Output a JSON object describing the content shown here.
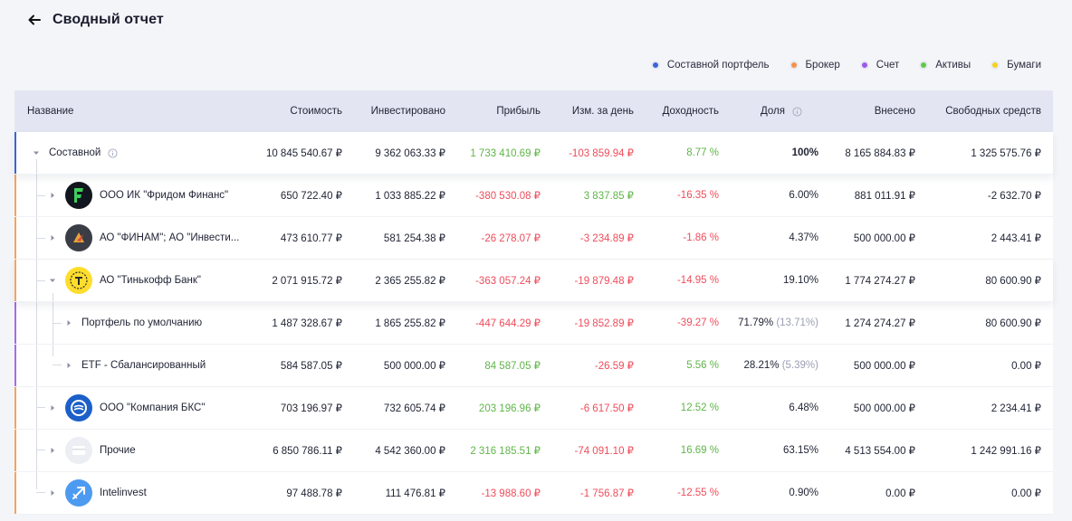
{
  "header": {
    "title": "Сводный отчет"
  },
  "legend": [
    {
      "label": "Составной портфель",
      "color": "#3a64d8"
    },
    {
      "label": "Брокер",
      "color": "#f5914a"
    },
    {
      "label": "Счет",
      "color": "#9b59e8"
    },
    {
      "label": "Активы",
      "color": "#5fc94a"
    },
    {
      "label": "Бумаги",
      "color": "#f5d21c"
    }
  ],
  "columns": {
    "name": "Название",
    "cost": "Стоимость",
    "invested": "Инвестировано",
    "profit": "Прибыль",
    "day_change": "Изм. за день",
    "yield": "Доходность",
    "share": "Доля",
    "deposited": "Внесено",
    "free_funds": "Свободных средств"
  },
  "rows": [
    {
      "name": "Составной",
      "cost": "10 845 540.67 ₽",
      "invested": "9 362 063.33 ₽",
      "profit": "1 733 410.69 ₽",
      "day_change": "-103 859.94 ₽",
      "yield": "8.77 %",
      "share": "100%",
      "share_sub": "",
      "deposited": "8 165 884.83 ₽",
      "free_funds": "1 325 575.76 ₽"
    },
    {
      "name": "ООО ИК \"Фридом Финанс\"",
      "cost": "650 722.40 ₽",
      "invested": "1 033 885.22 ₽",
      "profit": "-380 530.08 ₽",
      "day_change": "3 837.85 ₽",
      "yield": "-16.35 %",
      "share": "6.00%",
      "share_sub": "",
      "deposited": "881 011.91 ₽",
      "free_funds": "-2 632.70 ₽"
    },
    {
      "name": "АО \"ФИНАМ\"; АО \"Инвести...",
      "cost": "473 610.77 ₽",
      "invested": "581 254.38 ₽",
      "profit": "-26 278.07 ₽",
      "day_change": "-3 234.89 ₽",
      "yield": "-1.86 %",
      "share": "4.37%",
      "share_sub": "",
      "deposited": "500 000.00 ₽",
      "free_funds": "2 443.41 ₽"
    },
    {
      "name": "АО \"Тинькофф Банк\"",
      "cost": "2 071 915.72 ₽",
      "invested": "2 365 255.82 ₽",
      "profit": "-363 057.24 ₽",
      "day_change": "-19 879.48 ₽",
      "yield": "-14.95 %",
      "share": "19.10%",
      "share_sub": "",
      "deposited": "1 774 274.27 ₽",
      "free_funds": "80 600.90 ₽"
    },
    {
      "name": "Портфель по умолчанию",
      "cost": "1 487 328.67 ₽",
      "invested": "1 865 255.82 ₽",
      "profit": "-447 644.29 ₽",
      "day_change": "-19 852.89 ₽",
      "yield": "-39.27 %",
      "share": "71.79%",
      "share_sub": "(13.71%)",
      "deposited": "1 274 274.27 ₽",
      "free_funds": "80 600.90 ₽"
    },
    {
      "name": "ETF - Сбалансированный",
      "cost": "584 587.05 ₽",
      "invested": "500 000.00 ₽",
      "profit": "84 587.05 ₽",
      "day_change": "-26.59 ₽",
      "yield": "5.56 %",
      "share": "28.21%",
      "share_sub": "(5.39%)",
      "deposited": "500 000.00 ₽",
      "free_funds": "0.00 ₽"
    },
    {
      "name": "ООО \"Компания БКС\"",
      "cost": "703 196.97 ₽",
      "invested": "732 605.74 ₽",
      "profit": "203 196.96 ₽",
      "day_change": "-6 617.50 ₽",
      "yield": "12.52 %",
      "share": "6.48%",
      "share_sub": "",
      "deposited": "500 000.00 ₽",
      "free_funds": "2 234.41 ₽"
    },
    {
      "name": "Прочие",
      "cost": "6 850 786.11 ₽",
      "invested": "4 542 360.00 ₽",
      "profit": "2 316 185.51 ₽",
      "day_change": "-74 091.10 ₽",
      "yield": "16.69 %",
      "share": "63.15%",
      "share_sub": "",
      "deposited": "4 513 554.00 ₽",
      "free_funds": "1 242 991.16 ₽"
    },
    {
      "name": "Intelinvest",
      "cost": "97 488.78 ₽",
      "invested": "111 476.81 ₽",
      "profit": "-13 988.60 ₽",
      "day_change": "-1 756.87 ₽",
      "yield": "-12.55 %",
      "share": "0.90%",
      "share_sub": "",
      "deposited": "0.00 ₽",
      "free_funds": "0.00 ₽"
    }
  ]
}
